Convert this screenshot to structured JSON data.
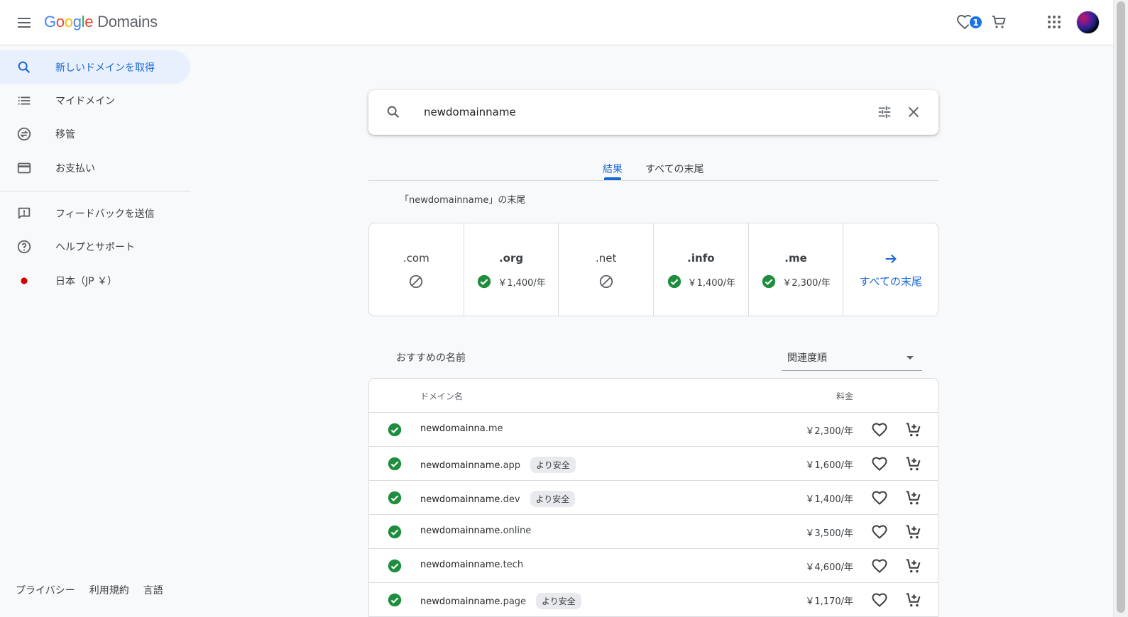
{
  "header": {
    "logo_google": [
      "G",
      "o",
      "o",
      "g",
      "l",
      "e"
    ],
    "logo_product": "Domains",
    "favorites_count": "1"
  },
  "sidebar": {
    "items": [
      {
        "label": "新しいドメインを取得",
        "icon": "search-icon"
      },
      {
        "label": "マイドメイン",
        "icon": "list-icon"
      },
      {
        "label": "移管",
        "icon": "transfer-icon"
      },
      {
        "label": "お支払い",
        "icon": "credit-card-icon"
      },
      {
        "label": "フィードバックを送信",
        "icon": "feedback-icon"
      },
      {
        "label": "ヘルプとサポート",
        "icon": "help-icon"
      },
      {
        "label": "日本（JP ￥）",
        "icon": "japan-flag-icon"
      }
    ],
    "footer": [
      "プライバシー",
      "利用規約",
      "言語"
    ]
  },
  "search": {
    "value": "newdomainname"
  },
  "tabs": {
    "results": "結果",
    "all_endings": "すべての末尾"
  },
  "endings": {
    "title": "「newdomainname」の末尾",
    "cards": [
      {
        "ext": ".com",
        "available": false,
        "price": ""
      },
      {
        "ext": ".org",
        "available": true,
        "price": "￥1,400/年"
      },
      {
        "ext": ".net",
        "available": false,
        "price": ""
      },
      {
        "ext": ".info",
        "available": true,
        "price": "￥1,400/年"
      },
      {
        "ext": ".me",
        "available": true,
        "price": "￥2,300/年"
      }
    ],
    "all_link": "すべての末尾"
  },
  "recommended": {
    "title": "おすすめの名前",
    "sort_value": "関連度順",
    "col_domain": "ドメイン名",
    "col_price": "料金",
    "rows": [
      {
        "base": "newdomainna",
        "tld": ".me",
        "chip": "",
        "price": "￥2,300/年"
      },
      {
        "base": "newdomainname",
        "tld": ".app",
        "chip": "より安全",
        "price": "￥1,600/年"
      },
      {
        "base": "newdomainname",
        "tld": ".dev",
        "chip": "より安全",
        "price": "￥1,400/年"
      },
      {
        "base": "newdomainname",
        "tld": ".online",
        "chip": "",
        "price": "￥3,500/年"
      },
      {
        "base": "newdomainname",
        "tld": ".tech",
        "chip": "",
        "price": "￥4,600/年"
      },
      {
        "base": "newdomainname",
        "tld": ".page",
        "chip": "より安全",
        "price": "￥1,170/年"
      }
    ]
  },
  "colors": {
    "accent": "#1967d2",
    "available_green": "#1e8e3e",
    "active_nav_bg": "#e8f0fe"
  }
}
